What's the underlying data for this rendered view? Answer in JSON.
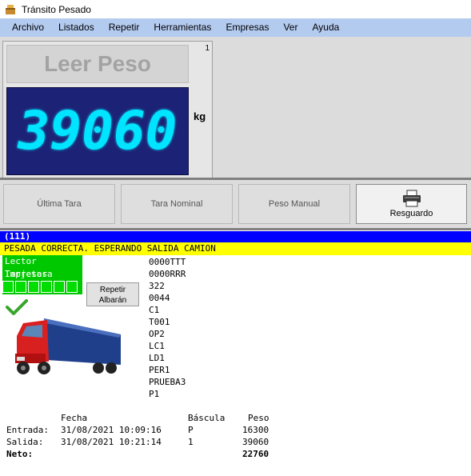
{
  "window": {
    "title": "Tránsito Pesado"
  },
  "menu": [
    "Archivo",
    "Listados",
    "Repetir",
    "Herramientas",
    "Empresas",
    "Ver",
    "Ayuda"
  ],
  "scale": {
    "number": "1",
    "read_button": "Leer Peso",
    "weight": "39060",
    "unit": "kg",
    "display_color": "#00e5ff"
  },
  "buttons": {
    "last_tare": "Última Tara",
    "nominal_tare": "Tara Nominal",
    "manual_weight": "Peso Manual",
    "receipt": "Resguardo"
  },
  "status": {
    "code": "(111)",
    "message": "PESADA CORRECTA. ESPERANDO SALIDA CAMION"
  },
  "devices": {
    "card_reader": "Lector Tarjetas",
    "printer": "Impresora"
  },
  "repeat_button": {
    "line1": "Repetir",
    "line2": "Albarán"
  },
  "codes": [
    "0000TTT",
    "0000RRR",
    "322",
    "0044",
    "C1",
    "T001",
    "OP2",
    "LC1",
    "LD1",
    "PER1",
    "PRUEBA3",
    "P1"
  ],
  "weighings": {
    "headers": {
      "date": "Fecha",
      "scale": "Báscula",
      "weight": "Peso"
    },
    "entry": {
      "label": "Entrada:",
      "date": "31/08/2021 10:09:16",
      "scale": "P",
      "weight": "16300"
    },
    "exit": {
      "label": "Salida:",
      "date": "31/08/2021 10:21:14",
      "scale": "1",
      "weight": "39060"
    },
    "net": {
      "label": "Neto:",
      "weight": "22760"
    }
  }
}
